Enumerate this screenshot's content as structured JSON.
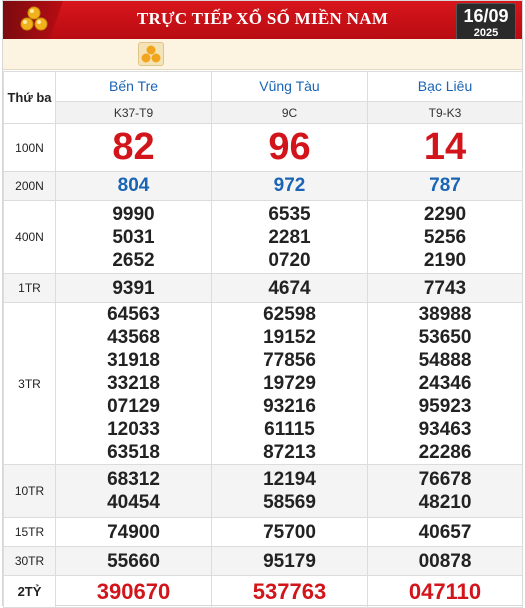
{
  "header": {
    "title": "TRỰC TIẾP XỔ SỐ MIỀN NAM",
    "date": "16/09",
    "year": "2025",
    "logo_icon": "lottery-balls-icon",
    "colors": {
      "accent": "#d2141b",
      "link": "#1a64b6"
    }
  },
  "subbar": {
    "icon": "lottery-balls-icon"
  },
  "table": {
    "day_label": "Thứ ba",
    "provinces": [
      {
        "name": "Bến Tre",
        "code": "K37-T9"
      },
      {
        "name": "Vũng Tàu",
        "code": "9C"
      },
      {
        "name": "Bạc Liêu",
        "code": "T9-K3"
      }
    ],
    "prizes": [
      {
        "label": "100N",
        "values": [
          [
            "82"
          ],
          [
            "96"
          ],
          [
            "14"
          ]
        ]
      },
      {
        "label": "200N",
        "values": [
          [
            "804"
          ],
          [
            "972"
          ],
          [
            "787"
          ]
        ]
      },
      {
        "label": "400N",
        "values": [
          [
            "9990",
            "5031",
            "2652"
          ],
          [
            "6535",
            "2281",
            "0720"
          ],
          [
            "2290",
            "5256",
            "2190"
          ]
        ]
      },
      {
        "label": "1TR",
        "values": [
          [
            "9391"
          ],
          [
            "4674"
          ],
          [
            "7743"
          ]
        ]
      },
      {
        "label": "3TR",
        "values": [
          [
            "64563",
            "43568",
            "31918",
            "33218",
            "07129",
            "12033",
            "63518"
          ],
          [
            "62598",
            "19152",
            "77856",
            "19729",
            "93216",
            "61115",
            "87213"
          ],
          [
            "38988",
            "53650",
            "54888",
            "24346",
            "95923",
            "93463",
            "22286"
          ]
        ]
      },
      {
        "label": "10TR",
        "values": [
          [
            "68312",
            "40454"
          ],
          [
            "12194",
            "58569"
          ],
          [
            "76678",
            "48210"
          ]
        ]
      },
      {
        "label": "15TR",
        "values": [
          [
            "74900"
          ],
          [
            "75700"
          ],
          [
            "40657"
          ]
        ]
      },
      {
        "label": "30TR",
        "values": [
          [
            "55660"
          ],
          [
            "95179"
          ],
          [
            "00878"
          ]
        ]
      },
      {
        "label": "2TỶ",
        "values": [
          [
            "390670"
          ],
          [
            "537763"
          ],
          [
            "047110"
          ]
        ]
      }
    ]
  }
}
